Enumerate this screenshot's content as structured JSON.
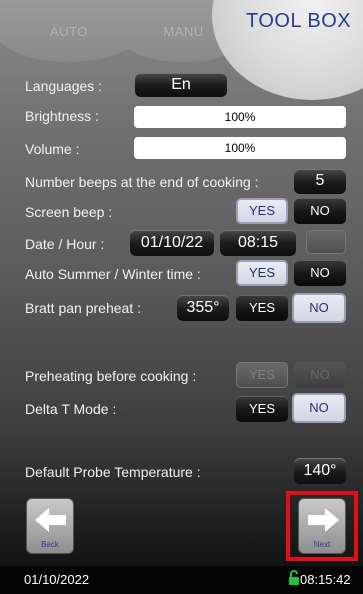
{
  "tabs": {
    "auto": "AUTO",
    "manu": "MANU",
    "toolbox": "TOOL BOX"
  },
  "settings": {
    "languages": {
      "label": "Languages :",
      "value": "En"
    },
    "brightness": {
      "label": "Brightness :",
      "value": "100%"
    },
    "volume": {
      "label": "Volume :",
      "value": "100%"
    },
    "beeps": {
      "label": "Number beeps at the end of cooking :",
      "value": "5"
    },
    "screen_beep": {
      "label": "Screen beep :",
      "yes": "YES",
      "no": "NO"
    },
    "date_hour": {
      "label": "Date / Hour :",
      "date": "01/10/22",
      "time": "08:15"
    },
    "auto_summer": {
      "label": "Auto Summer / Winter time :",
      "yes": "YES",
      "no": "NO"
    },
    "bratt_pan": {
      "label": "Bratt pan preheat :",
      "temp": "355°",
      "yes": "YES",
      "no": "NO"
    },
    "preheating": {
      "label": "Preheating before cooking :",
      "yes": "YES",
      "no": "NO"
    },
    "delta_t": {
      "label": "Delta T Mode :",
      "yes": "YES",
      "no": "NO"
    },
    "probe": {
      "label": "Default Probe Temperature :",
      "value": "140°"
    }
  },
  "nav": {
    "back": "Back",
    "next": "Next"
  },
  "status": {
    "date": "01/10/2022",
    "time": "08:15:42"
  },
  "colors": {
    "accent_blue": "#23336e",
    "highlight_red": "#e0101a",
    "lock_green": "#22c43a"
  }
}
